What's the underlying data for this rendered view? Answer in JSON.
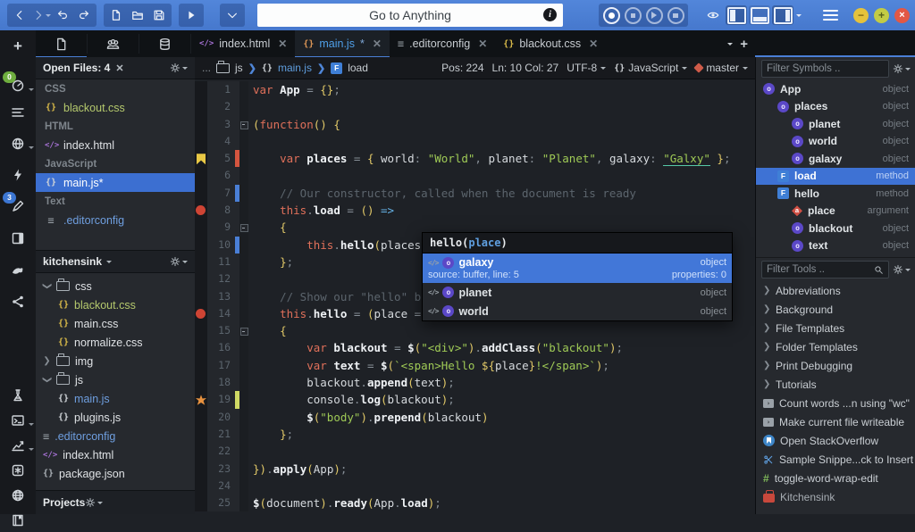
{
  "topbar": {
    "search_placeholder": "Go to Anything"
  },
  "rail": {
    "badges": {
      "gauge": "0",
      "syntax": "3"
    }
  },
  "tabs": [
    {
      "label": "index.html",
      "type": "html",
      "active": false,
      "modified": false
    },
    {
      "label": "main.js",
      "type": "js",
      "active": true,
      "modified": true
    },
    {
      "label": ".editorconfig",
      "type": "text",
      "active": false,
      "modified": false
    },
    {
      "label": "blackout.css",
      "type": "css",
      "active": false,
      "modified": false
    }
  ],
  "sidebar": {
    "open_files_title": "Open Files: 4",
    "groups": [
      {
        "name": "CSS",
        "files": [
          {
            "name": "blackout.css",
            "type": "css",
            "color": "css"
          }
        ]
      },
      {
        "name": "HTML",
        "files": [
          {
            "name": "index.html",
            "type": "html",
            "color": ""
          }
        ]
      },
      {
        "name": "JavaScript",
        "files": [
          {
            "name": "main.js*",
            "type": "js",
            "color": "",
            "selected": true
          }
        ]
      },
      {
        "name": "Text",
        "files": [
          {
            "name": ".editorconfig",
            "type": "text",
            "color": "link"
          }
        ]
      }
    ],
    "project_name": "kitchensink",
    "tree": [
      {
        "label": "css",
        "type": "folder",
        "state": "open",
        "depth": 0
      },
      {
        "label": "blackout.css",
        "type": "css",
        "depth": 1,
        "color": "css"
      },
      {
        "label": "main.css",
        "type": "css",
        "depth": 1,
        "color": ""
      },
      {
        "label": "normalize.css",
        "type": "css",
        "depth": 1,
        "color": ""
      },
      {
        "label": "img",
        "type": "folder",
        "state": "closed",
        "depth": 0
      },
      {
        "label": "js",
        "type": "folder",
        "state": "open",
        "depth": 0
      },
      {
        "label": "main.js",
        "type": "js",
        "depth": 1,
        "color": "link"
      },
      {
        "label": "plugins.js",
        "type": "js",
        "depth": 1,
        "color": ""
      },
      {
        "label": ".editorconfig",
        "type": "text",
        "depth": 0,
        "color": "link"
      },
      {
        "label": "index.html",
        "type": "html",
        "depth": 0,
        "color": ""
      },
      {
        "label": "package.json",
        "type": "json",
        "depth": 0,
        "color": ""
      }
    ],
    "projects_label": "Projects"
  },
  "breadcrumb": {
    "dots": "...",
    "folder": "js",
    "file": "main.js",
    "symbol": "load"
  },
  "status": {
    "pos": "Pos: 224",
    "ln_col": "Ln: 10 Col: 27",
    "encoding": "UTF-8",
    "language": "JavaScript",
    "branch": "master"
  },
  "editor": {
    "lines": [
      {
        "n": "1",
        "segs": [
          [
            "k",
            "var"
          ],
          [
            "p",
            " "
          ],
          [
            "b",
            "App"
          ],
          [
            "o",
            " = "
          ],
          [
            "y",
            "{}"
          ],
          [
            "o",
            ";"
          ]
        ]
      },
      {
        "n": "2",
        "segs": []
      },
      {
        "n": "3",
        "fold": true,
        "segs": [
          [
            "y",
            "("
          ],
          [
            "k",
            "function"
          ],
          [
            "y",
            "() {"
          ]
        ]
      },
      {
        "n": "4",
        "segs": []
      },
      {
        "n": "5",
        "mark": "bookmark",
        "bar": "red",
        "segs": [
          [
            "p",
            "    "
          ],
          [
            "k",
            "var"
          ],
          [
            "p",
            " "
          ],
          [
            "b",
            "places"
          ],
          [
            "o",
            " = "
          ],
          [
            "y",
            "{ "
          ],
          [
            "p",
            "world"
          ],
          [
            "o",
            ": "
          ],
          [
            "s",
            "\"World\""
          ],
          [
            "o",
            ", "
          ],
          [
            "p",
            "planet"
          ],
          [
            "o",
            ": "
          ],
          [
            "s",
            "\"Planet\""
          ],
          [
            "o",
            ", "
          ],
          [
            "p",
            "galaxy"
          ],
          [
            "o",
            ": "
          ],
          [
            "su",
            "\"Galxy\""
          ],
          [
            "y",
            " }"
          ],
          [
            "o",
            ";"
          ]
        ]
      },
      {
        "n": "6",
        "segs": []
      },
      {
        "n": "7",
        "bar": "blue",
        "segs": [
          [
            "c",
            "    // Our constructor, called when the document is ready"
          ]
        ]
      },
      {
        "n": "8",
        "mark": "breakpoint",
        "segs": [
          [
            "p",
            "    "
          ],
          [
            "k",
            "this"
          ],
          [
            "o",
            "."
          ],
          [
            "b",
            "load"
          ],
          [
            "o",
            " = "
          ],
          [
            "y",
            "()"
          ],
          [
            "p",
            " "
          ],
          [
            "a",
            "=>"
          ]
        ]
      },
      {
        "n": "9",
        "fold": true,
        "segs": [
          [
            "p",
            "    "
          ],
          [
            "y",
            "{"
          ]
        ]
      },
      {
        "n": "10",
        "bar": "blue",
        "segs": [
          [
            "p",
            "        "
          ],
          [
            "k",
            "this"
          ],
          [
            "o",
            "."
          ],
          [
            "b",
            "hello"
          ],
          [
            "y",
            "("
          ],
          [
            "p",
            "places"
          ],
          [
            "o",
            "."
          ],
          [
            "cr",
            ""
          ],
          [
            "bx",
            ")"
          ],
          [
            "o",
            ";"
          ]
        ]
      },
      {
        "n": "11",
        "segs": [
          [
            "p",
            "    "
          ],
          [
            "y",
            "}"
          ],
          [
            "o",
            ";"
          ]
        ]
      },
      {
        "n": "12",
        "segs": []
      },
      {
        "n": "13",
        "segs": [
          [
            "c",
            "    // Show our \"hello\" bl"
          ]
        ]
      },
      {
        "n": "14",
        "mark": "breakpoint",
        "segs": [
          [
            "p",
            "    "
          ],
          [
            "k",
            "this"
          ],
          [
            "o",
            "."
          ],
          [
            "b",
            "hello"
          ],
          [
            "o",
            " = "
          ],
          [
            "y",
            "("
          ],
          [
            "p",
            "place"
          ],
          [
            "o",
            " = "
          ]
        ]
      },
      {
        "n": "15",
        "fold": true,
        "segs": [
          [
            "p",
            "    "
          ],
          [
            "y",
            "{"
          ]
        ]
      },
      {
        "n": "16",
        "segs": [
          [
            "p",
            "        "
          ],
          [
            "k",
            "var"
          ],
          [
            "p",
            " "
          ],
          [
            "b",
            "blackout"
          ],
          [
            "o",
            " = "
          ],
          [
            "b",
            "$"
          ],
          [
            "y",
            "("
          ],
          [
            "s",
            "\"<div>\""
          ],
          [
            "y",
            ")"
          ],
          [
            "o",
            "."
          ],
          [
            "b",
            "addClass"
          ],
          [
            "y",
            "("
          ],
          [
            "s",
            "\"blackout\""
          ],
          [
            "y",
            ")"
          ],
          [
            "o",
            ";"
          ]
        ]
      },
      {
        "n": "17",
        "segs": [
          [
            "p",
            "        "
          ],
          [
            "k",
            "var"
          ],
          [
            "p",
            " "
          ],
          [
            "b",
            "text"
          ],
          [
            "o",
            " = "
          ],
          [
            "b",
            "$"
          ],
          [
            "y",
            "("
          ],
          [
            "s",
            "`<span>Hello "
          ],
          [
            "y",
            "${"
          ],
          [
            "p",
            "place"
          ],
          [
            "y",
            "}"
          ],
          [
            "s",
            "!</span>`"
          ],
          [
            "y",
            ")"
          ],
          [
            "o",
            ";"
          ]
        ]
      },
      {
        "n": "18",
        "segs": [
          [
            "p",
            "        blackout"
          ],
          [
            "o",
            "."
          ],
          [
            "b",
            "append"
          ],
          [
            "y",
            "("
          ],
          [
            "p",
            "text"
          ],
          [
            "y",
            ")"
          ],
          [
            "o",
            ";"
          ]
        ]
      },
      {
        "n": "19",
        "mark": "burst",
        "bar": "yellow",
        "segs": [
          [
            "p",
            "        console"
          ],
          [
            "o",
            "."
          ],
          [
            "b",
            "log"
          ],
          [
            "y",
            "("
          ],
          [
            "p",
            "blackout"
          ],
          [
            "y",
            ")"
          ],
          [
            "o",
            ";"
          ]
        ]
      },
      {
        "n": "20",
        "segs": [
          [
            "p",
            "        "
          ],
          [
            "b",
            "$"
          ],
          [
            "y",
            "("
          ],
          [
            "s",
            "\"body\""
          ],
          [
            "y",
            ")"
          ],
          [
            "o",
            "."
          ],
          [
            "b",
            "prepend"
          ],
          [
            "y",
            "("
          ],
          [
            "p",
            "blackout"
          ],
          [
            "y",
            ")"
          ]
        ]
      },
      {
        "n": "21",
        "segs": [
          [
            "p",
            "    "
          ],
          [
            "y",
            "}"
          ],
          [
            "o",
            ";"
          ]
        ]
      },
      {
        "n": "22",
        "segs": []
      },
      {
        "n": "23",
        "segs": [
          [
            "y",
            "})"
          ],
          [
            "o",
            "."
          ],
          [
            "b",
            "apply"
          ],
          [
            "y",
            "("
          ],
          [
            "p",
            "App"
          ],
          [
            "y",
            ")"
          ],
          [
            "o",
            ";"
          ]
        ]
      },
      {
        "n": "24",
        "segs": []
      },
      {
        "n": "25",
        "segs": [
          [
            "b",
            "$"
          ],
          [
            "y",
            "("
          ],
          [
            "p",
            "document"
          ],
          [
            "y",
            ")"
          ],
          [
            "o",
            "."
          ],
          [
            "b",
            "ready"
          ],
          [
            "y",
            "("
          ],
          [
            "p",
            "App"
          ],
          [
            "o",
            "."
          ],
          [
            "b",
            "load"
          ],
          [
            "y",
            ")"
          ],
          [
            "o",
            ";"
          ]
        ]
      }
    ]
  },
  "popup": {
    "calltip": {
      "before": "hello(",
      "param": "place",
      "after": ")"
    },
    "rows": [
      {
        "name": "galaxy",
        "type": "object",
        "selected": true,
        "detail_left": "source: buffer, line: 5",
        "detail_right": "properties: 0"
      },
      {
        "name": "planet",
        "type": "object",
        "selected": false
      },
      {
        "name": "world",
        "type": "object",
        "selected": false
      }
    ]
  },
  "symbols": {
    "placeholder": "Filter Symbols ..",
    "rows": [
      {
        "name": "App",
        "kind": "object",
        "type": "object",
        "depth": 0
      },
      {
        "name": "places",
        "kind": "object",
        "type": "object",
        "depth": 1
      },
      {
        "name": "planet",
        "kind": "object",
        "type": "object",
        "depth": 2
      },
      {
        "name": "world",
        "kind": "object",
        "type": "object",
        "depth": 2
      },
      {
        "name": "galaxy",
        "kind": "object",
        "type": "object",
        "depth": 2
      },
      {
        "name": "load",
        "kind": "method",
        "type": "method",
        "depth": 1,
        "selected": true
      },
      {
        "name": "hello",
        "kind": "method",
        "type": "method",
        "depth": 1
      },
      {
        "name": "place",
        "kind": "argument",
        "type": "argument",
        "depth": 2
      },
      {
        "name": "blackout",
        "kind": "object",
        "type": "object",
        "depth": 2
      },
      {
        "name": "text",
        "kind": "object",
        "type": "object",
        "depth": 2
      }
    ]
  },
  "tools": {
    "placeholder": "Filter Tools ..",
    "folders": [
      "Abbreviations",
      "Background",
      "File Templates",
      "Folder Templates",
      "Print Debugging",
      "Tutorials"
    ],
    "items": [
      {
        "label": "Count words ...n using \"wc\"",
        "icon": "macro",
        "dim": false
      },
      {
        "label": "Make current file writeable",
        "icon": "macro",
        "dim": false
      },
      {
        "label": "Open StackOverflow",
        "icon": "stackoverflow",
        "dim": false
      },
      {
        "label": "Sample Snippe...ck to Insert",
        "icon": "scissors",
        "dim": false
      },
      {
        "label": "toggle-word-wrap-edit",
        "icon": "hash",
        "dim": false
      },
      {
        "label": "Kitchensink",
        "icon": "toolbox",
        "dim": true
      }
    ]
  }
}
